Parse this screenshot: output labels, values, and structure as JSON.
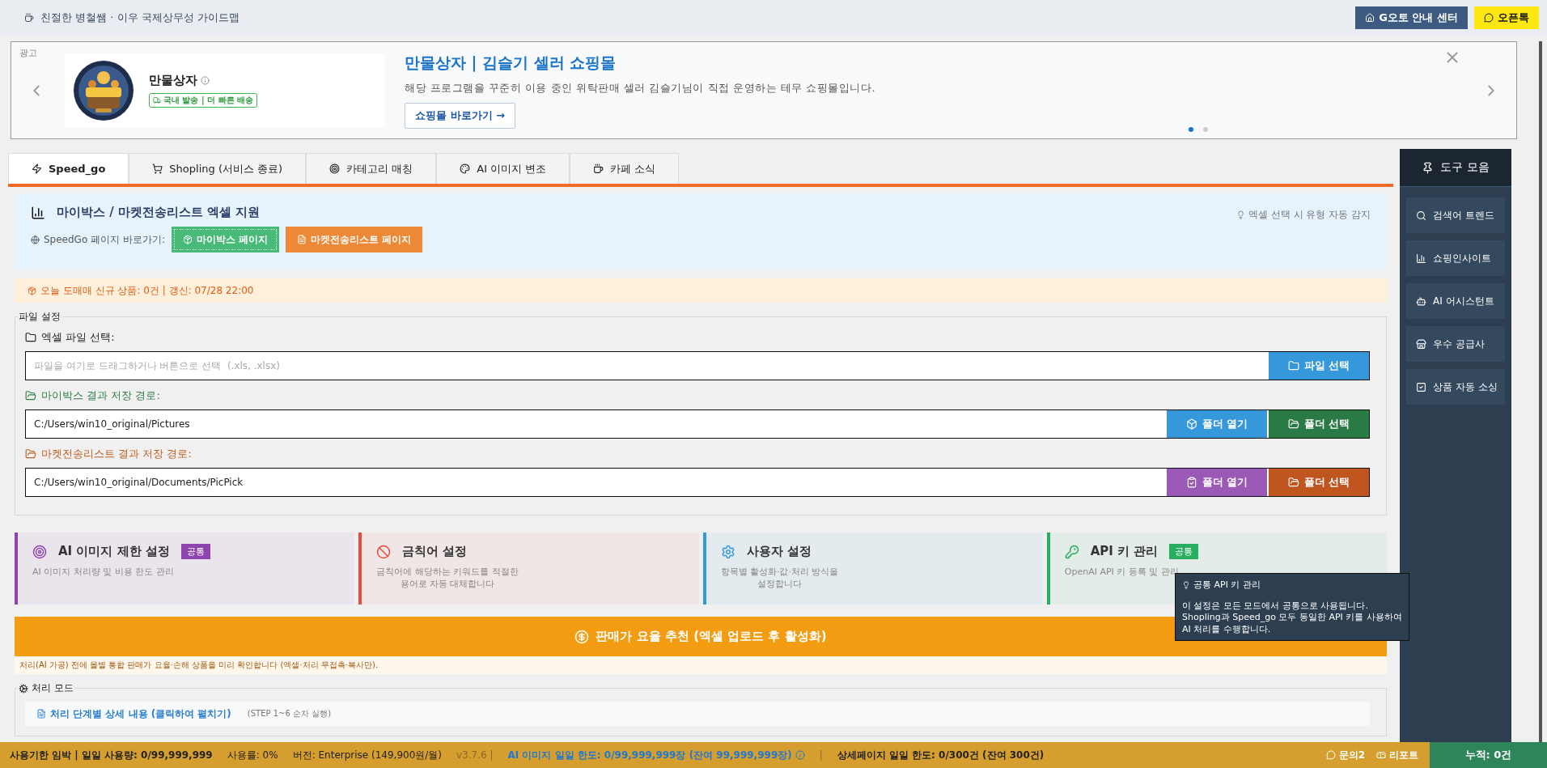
{
  "top_bar": {
    "title": "친절한 병철쌤 · 이우 국제상무성 가이드맵",
    "buttons": [
      {
        "label": "G오토 안내 센터",
        "color": "#3d5a80"
      },
      {
        "label": "오픈톡",
        "color": "#ffe812"
      }
    ]
  },
  "ad": {
    "tag": "광고",
    "brand": "만물상자",
    "badge": "국내 발송 | 더 빠른 배송",
    "title": "만물상자 | 김슬기 셀러 쇼핑몰",
    "description": "해당 프로그램을 꾸준히 이용 중인 위탁판매 셀러 김슬기님이 직접 운영하는 테무 쇼핑몰입니다.",
    "button": "쇼핑몰 바로가기 →",
    "dots": [
      {
        "selected": true
      },
      {
        "selected": false
      }
    ]
  },
  "tabs": [
    {
      "label": "Speed_go",
      "selected": true
    },
    {
      "label": "Shopling (서비스 종료)",
      "selected": false
    },
    {
      "label": "카테고리 매칭",
      "selected": false
    },
    {
      "label": "AI 이미지 변조",
      "selected": false
    },
    {
      "label": "카페 소식",
      "selected": false
    }
  ],
  "excel_panel": {
    "title": "마이박스 / 마켓전송리스트 엑셀 지원",
    "hint": "엑셀 선택 시 유형 자동 감지",
    "shortcut_label": "SpeedGo 페이지 바로가기:",
    "buttons": [
      {
        "label": "마이박스 페이지",
        "color": "#48bb78",
        "focused": true
      },
      {
        "label": "마켓전송리스트 페이지",
        "color": "#ed8936",
        "focused": false
      }
    ]
  },
  "notice": "오늘 도매매 신규 상품: 0건 | 갱신: 07/28 22:00",
  "file_settings": {
    "legend": "파일 설정",
    "rows": [
      {
        "label": "엑셀 파일 선택:",
        "color": "#222222",
        "placeholder": "파일을 여기로 드래그하거나 버튼으로 선택  (.xls, .xlsx)",
        "buttons": [
          {
            "label": "파일 선택",
            "color": "#3498db",
            "kind": "file"
          }
        ]
      },
      {
        "label": "마이박스 결과 저장 경로:",
        "color": "#2e7d46",
        "value": "C:/Users/win10_original/Pictures",
        "buttons": [
          {
            "label": "폴더 열기",
            "color": "#3498db",
            "kind": "open"
          },
          {
            "label": "폴더 선택",
            "color": "#2a7a45",
            "kind": "select"
          }
        ]
      },
      {
        "label": "마켓전송리스트 결과 저장 경로:",
        "color": "#c0601f",
        "value": "C:/Users/win10_original/Documents/PicPick",
        "buttons": [
          {
            "label": "폴더 열기",
            "color": "#9b59b6",
            "kind": "open"
          },
          {
            "label": "폴더 선택",
            "color": "#c0561f",
            "kind": "select"
          }
        ]
      }
    ]
  },
  "cards": [
    {
      "title": "AI 이미지 제한 설정",
      "badge": "공통",
      "description": "AI 이미지 처리량 및 비용 한도 관리",
      "color": "#8e44ad"
    },
    {
      "title": "금칙어 설정",
      "description": "금칙어에 해당하는 키워드를 적절한\n용어로 자동 대체합니다",
      "color": "#e74c3c"
    },
    {
      "title": "사용자 설정",
      "description": "항목별 활성화·값·처리 방식을\n설정합니다",
      "color": "#3498db"
    },
    {
      "title": "API 키 관리",
      "badge": "공통",
      "description": "OpenAI API 키 등록 및 관리",
      "color": "#27ae60"
    }
  ],
  "recommend_button": "판매가 요율 추천 (엑셀 업로드 후 활성화)",
  "recommend_note": "처리(AI 가공) 전에 몰별 통합 판매가 요율·손해 상품을 미리 확인합니다 (엑셀·처리 무접촉·복사만).",
  "process_mode": {
    "legend": "처리 모드",
    "link": "처리 단계별 상세 내용 (클릭하여 펼치기)",
    "note": "(STEP 1~6 순차 실행)"
  },
  "tooltip": {
    "title": "공통 API 키 관리",
    "body": "이 설정은 모든 모드에서 공통으로 사용됩니다.\nShopling과 Speed_go 모두 동일한 API 키를 사용하여\nAI 처리를 수행합니다."
  },
  "sidebar": {
    "title": "도구 모음",
    "items": [
      {
        "label": "검색어 트렌드"
      },
      {
        "label": "쇼핑인사이트"
      },
      {
        "label": "AI 어시스턴트"
      },
      {
        "label": "우수 공급사"
      },
      {
        "label": "상품 자동 소싱"
      }
    ]
  },
  "status_bar": {
    "items": [
      {
        "text": "사용기한 임박 | 일일 사용량: 0/99,999,999",
        "kind": "bold"
      },
      {
        "text": "사용률: 0%",
        "kind": "plain"
      },
      {
        "text": "버전: Enterprise (149,900원/월)",
        "kind": "plain"
      },
      {
        "text": "v3.7.6 |",
        "kind": "muted"
      },
      {
        "text": "AI 이미지 일일 한도: 0/99,999,999장 (잔여 99,999,999장)",
        "kind": "accent"
      },
      {
        "text": "|",
        "kind": "muted"
      },
      {
        "text": "상세페이지 일일 한도: 0/300건 (잔여 300건)",
        "kind": "bold"
      }
    ],
    "links": [
      {
        "label": "문의2"
      },
      {
        "label": "리포트"
      }
    ],
    "total": "누적: 0건"
  }
}
